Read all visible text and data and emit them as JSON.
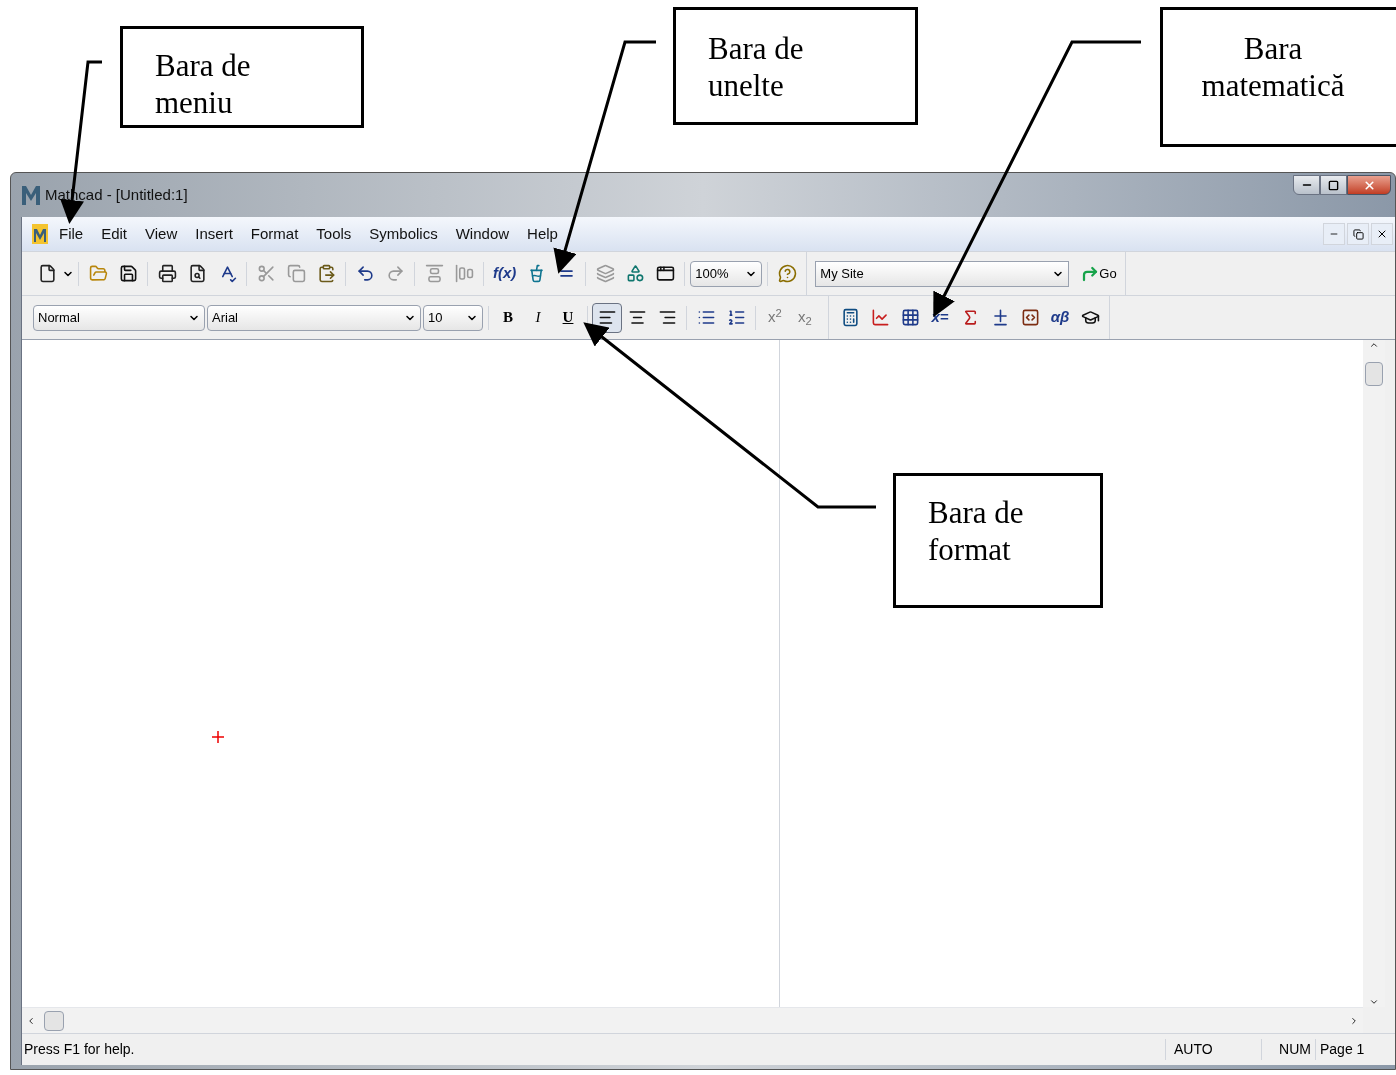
{
  "callouts": [
    {
      "lines": [
        "Bara de",
        "meniu"
      ]
    },
    {
      "lines": [
        "Bara de",
        "unelte"
      ]
    },
    {
      "lines": [
        "Bara",
        "matematică"
      ]
    },
    {
      "lines": [
        "Bara de",
        "format"
      ]
    }
  ],
  "window": {
    "title": "Mathcad - [Untitled:1]"
  },
  "menu": {
    "items": [
      "File",
      "Edit",
      "View",
      "Insert",
      "Format",
      "Tools",
      "Symbolics",
      "Window",
      "Help"
    ]
  },
  "standard_toolbar": {
    "items": [
      {
        "kind": "button",
        "disabled": false
      },
      {
        "kind": "caret",
        "disabled": false
      },
      {
        "kind": "separator"
      },
      {
        "kind": "button",
        "disabled": false
      },
      {
        "kind": "button",
        "disabled": false
      },
      {
        "kind": "separator"
      },
      {
        "kind": "button",
        "disabled": false
      },
      {
        "kind": "button",
        "disabled": false
      },
      {
        "kind": "button",
        "disabled": false
      },
      {
        "kind": "separator"
      },
      {
        "kind": "button",
        "disabled": true
      },
      {
        "kind": "button",
        "disabled": true
      },
      {
        "kind": "button",
        "disabled": false
      },
      {
        "kind": "separator"
      },
      {
        "kind": "button",
        "disabled": false
      },
      {
        "kind": "button",
        "disabled": true
      },
      {
        "kind": "separator"
      },
      {
        "kind": "button",
        "disabled": true
      },
      {
        "kind": "button",
        "disabled": true
      },
      {
        "kind": "separator"
      },
      {
        "kind": "text",
        "label": "f(x)",
        "disabled": false
      },
      {
        "kind": "button",
        "disabled": false
      },
      {
        "kind": "button",
        "disabled": false
      },
      {
        "kind": "separator"
      },
      {
        "kind": "button",
        "disabled": true
      },
      {
        "kind": "button",
        "disabled": false
      },
      {
        "kind": "button",
        "disabled": false
      },
      {
        "kind": "separator"
      },
      {
        "kind": "dropdown",
        "value": "100%"
      },
      {
        "kind": "separator"
      },
      {
        "kind": "button",
        "disabled": false
      }
    ]
  },
  "web_toolbar": {
    "site": "My Site",
    "go": "Go"
  },
  "format_toolbar": {
    "items": [
      {
        "kind": "dropdown",
        "value": "Normal"
      },
      {
        "kind": "dropdown",
        "value": "Arial"
      },
      {
        "kind": "dropdown",
        "value": "10"
      },
      {
        "kind": "separator"
      },
      {
        "kind": "bold",
        "label": "B",
        "disabled": false
      },
      {
        "kind": "italic",
        "label": "I",
        "disabled": false
      },
      {
        "kind": "underline",
        "label": "U",
        "disabled": false
      },
      {
        "kind": "separator"
      },
      {
        "kind": "button",
        "disabled": false,
        "selected": true
      },
      {
        "kind": "button",
        "disabled": false,
        "selected": false
      },
      {
        "kind": "button",
        "disabled": false,
        "selected": false
      },
      {
        "kind": "separator"
      },
      {
        "kind": "button",
        "disabled": false
      },
      {
        "kind": "button",
        "disabled": false
      },
      {
        "kind": "separator"
      },
      {
        "kind": "text",
        "label": "x$^{2}$",
        "disabled": true
      },
      {
        "kind": "text",
        "label": "x$_{2}$",
        "disabled": true
      }
    ]
  },
  "math_toolbar": {
    "items": [
      {
        "kind": "button",
        "disabled": false
      },
      {
        "kind": "button",
        "disabled": false
      },
      {
        "kind": "button",
        "disabled": false
      },
      {
        "kind": "text",
        "label": "x=",
        "disabled": false
      },
      {
        "kind": "button",
        "disabled": false
      },
      {
        "kind": "button",
        "disabled": false
      },
      {
        "kind": "button",
        "disabled": false
      },
      {
        "kind": "text",
        "label": "αβ",
        "disabled": false
      },
      {
        "kind": "button",
        "disabled": false
      }
    ]
  },
  "status_bar": {
    "message": "Press F1 for help.",
    "mode": "AUTO",
    "num": "NUM",
    "page": "Page 1"
  }
}
